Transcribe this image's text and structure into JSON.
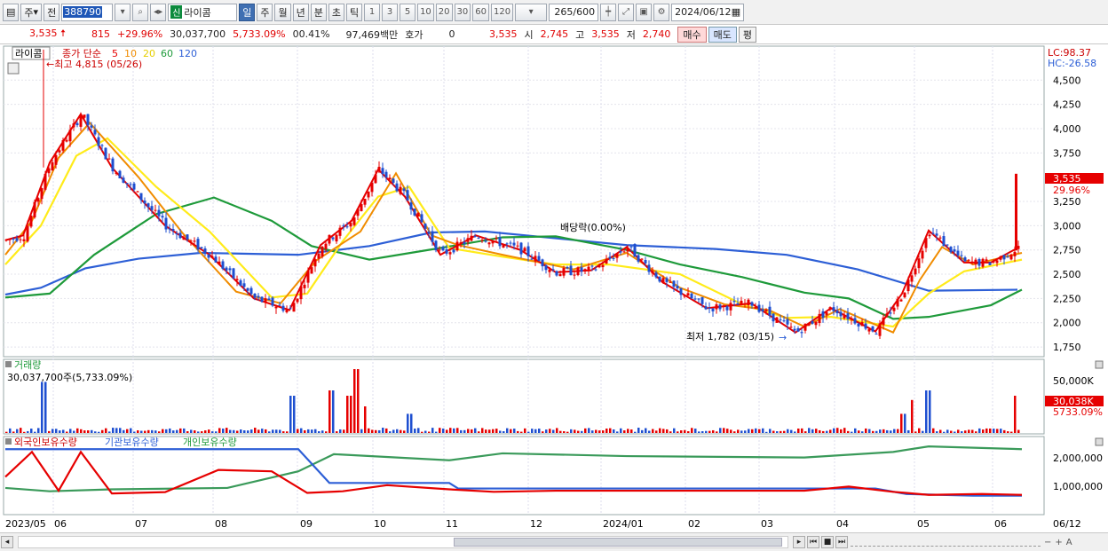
{
  "toolbar": {
    "market": "주",
    "mode": "전",
    "code": "388790",
    "new_badge": "신",
    "name": "라이콤",
    "periods": [
      "일",
      "주",
      "월",
      "년",
      "분",
      "초",
      "틱"
    ],
    "active_period": "일",
    "intervals": [
      "1",
      "3",
      "5",
      "10",
      "20",
      "30",
      "60",
      "120"
    ],
    "count": "265",
    "count_max": "/600",
    "date": "2024/06/12"
  },
  "infobar": {
    "price": "3,535",
    "change": "815",
    "change_pct": "+29.96%",
    "volume": "30,037,700",
    "volume_pct": "5,733.09%",
    "turnover": "00.41%",
    "amount": "97,469백만",
    "quote_label": "호가",
    "quote_value": "0",
    "quote_price": "3,535",
    "open_label": "시",
    "open": "2,745",
    "high_label": "고",
    "high": "3,535",
    "low_label": "저",
    "low": "2,740",
    "buy": "매수",
    "sell": "매도",
    "avg": "평"
  },
  "price_panel": {
    "title": "라이콤",
    "ma_label": "종가 단순",
    "ma_periods": [
      "5",
      "10",
      "20",
      "60",
      "120"
    ],
    "max_note": "최고 4,815 (05/26)",
    "min_note": "최저 1,782 (03/15)",
    "dividend_note": "배당락(0.00%)",
    "lc": "LC:98.37",
    "hc": "HC:-26.58",
    "current_price": "3,535",
    "current_pct": "29.96%",
    "axis_labels": [
      "4,500",
      "4,250",
      "4,000",
      "3,750",
      "3,250",
      "3,000",
      "2,750",
      "2,500",
      "2,250",
      "2,000",
      "1,750"
    ]
  },
  "volume_panel": {
    "title": "거래량",
    "summary": "30,037,700주(5,733.09%)",
    "axis_label": "50,000K",
    "current": "30,038K",
    "current_pct": "5733.09%"
  },
  "holdings_panel": {
    "legend": [
      "외국인보유수량",
      "기관보유수량",
      "개인보유수량"
    ],
    "axis_labels": [
      "2,000,000",
      "1,000,000"
    ]
  },
  "x_axis": [
    "2023/05",
    "06",
    "07",
    "08",
    "09",
    "10",
    "11",
    "12",
    "2024/01",
    "02",
    "03",
    "04",
    "05",
    "06",
    "06/12"
  ],
  "colors": {
    "ma5": "#e60000",
    "ma10": "#f08c00",
    "ma20": "#ffeb1a",
    "ma60": "#1e9a3a",
    "ma120": "#2d5fd6",
    "foreign": "#2d5fd6",
    "institution": "#e60000",
    "individual": "#3a9a5a"
  },
  "chart_data": {
    "type": "candlestick",
    "ylim": [
      1650,
      4850
    ],
    "ma120": [
      [
        0,
        2290
      ],
      [
        40,
        2360
      ],
      [
        90,
        2560
      ],
      [
        150,
        2660
      ],
      [
        220,
        2720
      ],
      [
        330,
        2700
      ],
      [
        410,
        2790
      ],
      [
        480,
        2930
      ],
      [
        540,
        2940
      ],
      [
        620,
        2870
      ],
      [
        700,
        2800
      ],
      [
        800,
        2760
      ],
      [
        880,
        2700
      ],
      [
        960,
        2550
      ],
      [
        1040,
        2330
      ],
      [
        1140,
        2340
      ]
    ],
    "ma60": [
      [
        0,
        2260
      ],
      [
        50,
        2300
      ],
      [
        100,
        2700
      ],
      [
        170,
        3120
      ],
      [
        235,
        3290
      ],
      [
        300,
        3050
      ],
      [
        345,
        2790
      ],
      [
        410,
        2650
      ],
      [
        490,
        2770
      ],
      [
        560,
        2880
      ],
      [
        620,
        2890
      ],
      [
        700,
        2750
      ],
      [
        760,
        2600
      ],
      [
        830,
        2470
      ],
      [
        900,
        2310
      ],
      [
        950,
        2250
      ],
      [
        1000,
        2040
      ],
      [
        1040,
        2060
      ],
      [
        1110,
        2180
      ],
      [
        1145,
        2340
      ]
    ],
    "ma20": [
      [
        0,
        2600
      ],
      [
        40,
        3000
      ],
      [
        80,
        3720
      ],
      [
        115,
        3900
      ],
      [
        170,
        3400
      ],
      [
        230,
        2940
      ],
      [
        300,
        2260
      ],
      [
        340,
        2300
      ],
      [
        380,
        2840
      ],
      [
        420,
        3300
      ],
      [
        455,
        3400
      ],
      [
        500,
        2770
      ],
      [
        560,
        2680
      ],
      [
        620,
        2600
      ],
      [
        680,
        2600
      ],
      [
        760,
        2500
      ],
      [
        830,
        2190
      ],
      [
        880,
        2050
      ],
      [
        930,
        2060
      ],
      [
        1000,
        1960
      ],
      [
        1040,
        2300
      ],
      [
        1080,
        2530
      ],
      [
        1145,
        2650
      ]
    ],
    "ma10": [
      [
        0,
        2700
      ],
      [
        30,
        3050
      ],
      [
        60,
        3700
      ],
      [
        95,
        4060
      ],
      [
        150,
        3500
      ],
      [
        200,
        2920
      ],
      [
        260,
        2320
      ],
      [
        310,
        2200
      ],
      [
        350,
        2640
      ],
      [
        400,
        2940
      ],
      [
        440,
        3540
      ],
      [
        480,
        2900
      ],
      [
        510,
        2800
      ],
      [
        560,
        2700
      ],
      [
        640,
        2550
      ],
      [
        700,
        2720
      ],
      [
        760,
        2360
      ],
      [
        810,
        2190
      ],
      [
        860,
        2130
      ],
      [
        900,
        1960
      ],
      [
        940,
        2140
      ],
      [
        1000,
        1900
      ],
      [
        1030,
        2440
      ],
      [
        1055,
        2780
      ],
      [
        1090,
        2600
      ],
      [
        1145,
        2720
      ]
    ],
    "ma5": [
      [
        0,
        2850
      ],
      [
        20,
        2900
      ],
      [
        50,
        3650
      ],
      [
        85,
        4150
      ],
      [
        120,
        3600
      ],
      [
        180,
        3000
      ],
      [
        230,
        2700
      ],
      [
        280,
        2250
      ],
      [
        320,
        2130
      ],
      [
        355,
        2800
      ],
      [
        390,
        3050
      ],
      [
        420,
        3580
      ],
      [
        450,
        3300
      ],
      [
        490,
        2700
      ],
      [
        530,
        2900
      ],
      [
        580,
        2750
      ],
      [
        620,
        2520
      ],
      [
        660,
        2540
      ],
      [
        700,
        2780
      ],
      [
        740,
        2420
      ],
      [
        790,
        2150
      ],
      [
        840,
        2200
      ],
      [
        890,
        1900
      ],
      [
        930,
        2150
      ],
      [
        980,
        1910
      ],
      [
        1010,
        2300
      ],
      [
        1040,
        2950
      ],
      [
        1080,
        2620
      ],
      [
        1110,
        2620
      ],
      [
        1140,
        2770
      ]
    ],
    "foreign": [
      [
        0,
        2300000
      ],
      [
        330,
        2300000
      ],
      [
        365,
        1080000
      ],
      [
        500,
        1080000
      ],
      [
        510,
        880000
      ],
      [
        980,
        880000
      ],
      [
        1015,
        680000
      ],
      [
        1090,
        620000
      ],
      [
        1145,
        620000
      ]
    ],
    "institution": [
      [
        0,
        1300000
      ],
      [
        30,
        2200000
      ],
      [
        60,
        800000
      ],
      [
        85,
        2200000
      ],
      [
        120,
        700000
      ],
      [
        180,
        750000
      ],
      [
        240,
        1550000
      ],
      [
        300,
        1500000
      ],
      [
        340,
        720000
      ],
      [
        380,
        780000
      ],
      [
        430,
        1000000
      ],
      [
        500,
        850000
      ],
      [
        550,
        760000
      ],
      [
        620,
        800000
      ],
      [
        700,
        800000
      ],
      [
        800,
        800000
      ],
      [
        900,
        800000
      ],
      [
        950,
        950000
      ],
      [
        1000,
        760000
      ],
      [
        1040,
        650000
      ],
      [
        1100,
        680000
      ],
      [
        1145,
        650000
      ]
    ],
    "individual": [
      [
        0,
        900000
      ],
      [
        50,
        780000
      ],
      [
        120,
        850000
      ],
      [
        250,
        900000
      ],
      [
        330,
        1500000
      ],
      [
        370,
        2120000
      ],
      [
        500,
        1900000
      ],
      [
        560,
        2150000
      ],
      [
        700,
        2050000
      ],
      [
        900,
        2000000
      ],
      [
        1000,
        2200000
      ],
      [
        1040,
        2400000
      ],
      [
        1145,
        2300000
      ]
    ]
  }
}
